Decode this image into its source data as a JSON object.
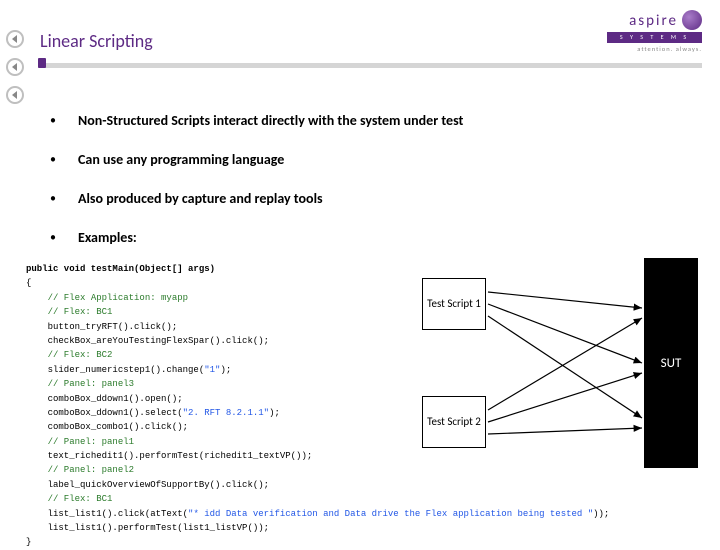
{
  "header": {
    "title": "Linear Scripting"
  },
  "logo": {
    "name": "aspire",
    "sub": "S Y S T E M S",
    "tag": "attention. always."
  },
  "bullets": [
    "Non-Structured Scripts interact directly with the system under test",
    "Can use any programming language",
    "Also produced by capture and replay tools",
    "Examples:"
  ],
  "code": {
    "sig": "public void testMain(Object[] args)",
    "open": "{",
    "l1": "// Flex Application: myapp",
    "l2": "// Flex: BC1",
    "l3": "button_tryRFT().click();",
    "l4": "checkBox_areYouTestingFlexSpar().click();",
    "l5": "// Flex: BC2",
    "l6a": "slider_numericstep1().change(",
    "l6b": "\"1\"",
    "l6c": ");",
    "l7": "// Panel: panel3",
    "l8": "comboBox_ddown1().open();",
    "l9a": "comboBox_ddown1().select(",
    "l9b": "\"2. RFT 8.2.1.1\"",
    "l9c": ");",
    "l10": "comboBox_combo1().click();",
    "l11": "// Panel: panel1",
    "l12": "text_richedit1().performTest(richedit1_textVP());",
    "l13": "// Panel: panel2",
    "l14": "label_quickOverviewOfSupportBy().click();",
    "l15": "// Flex: BC1",
    "l16a": "list_list1().click(atText(",
    "l16b": "\"* idd Data verification and Data drive the Flex application being tested \"",
    "l16c": "));",
    "l17": "list_list1().performTest(list1_listVP());",
    "close": "}"
  },
  "diagram": {
    "box1": "Test\nScript 1",
    "box2": "Test\nScript 2",
    "sut": "SUT"
  }
}
